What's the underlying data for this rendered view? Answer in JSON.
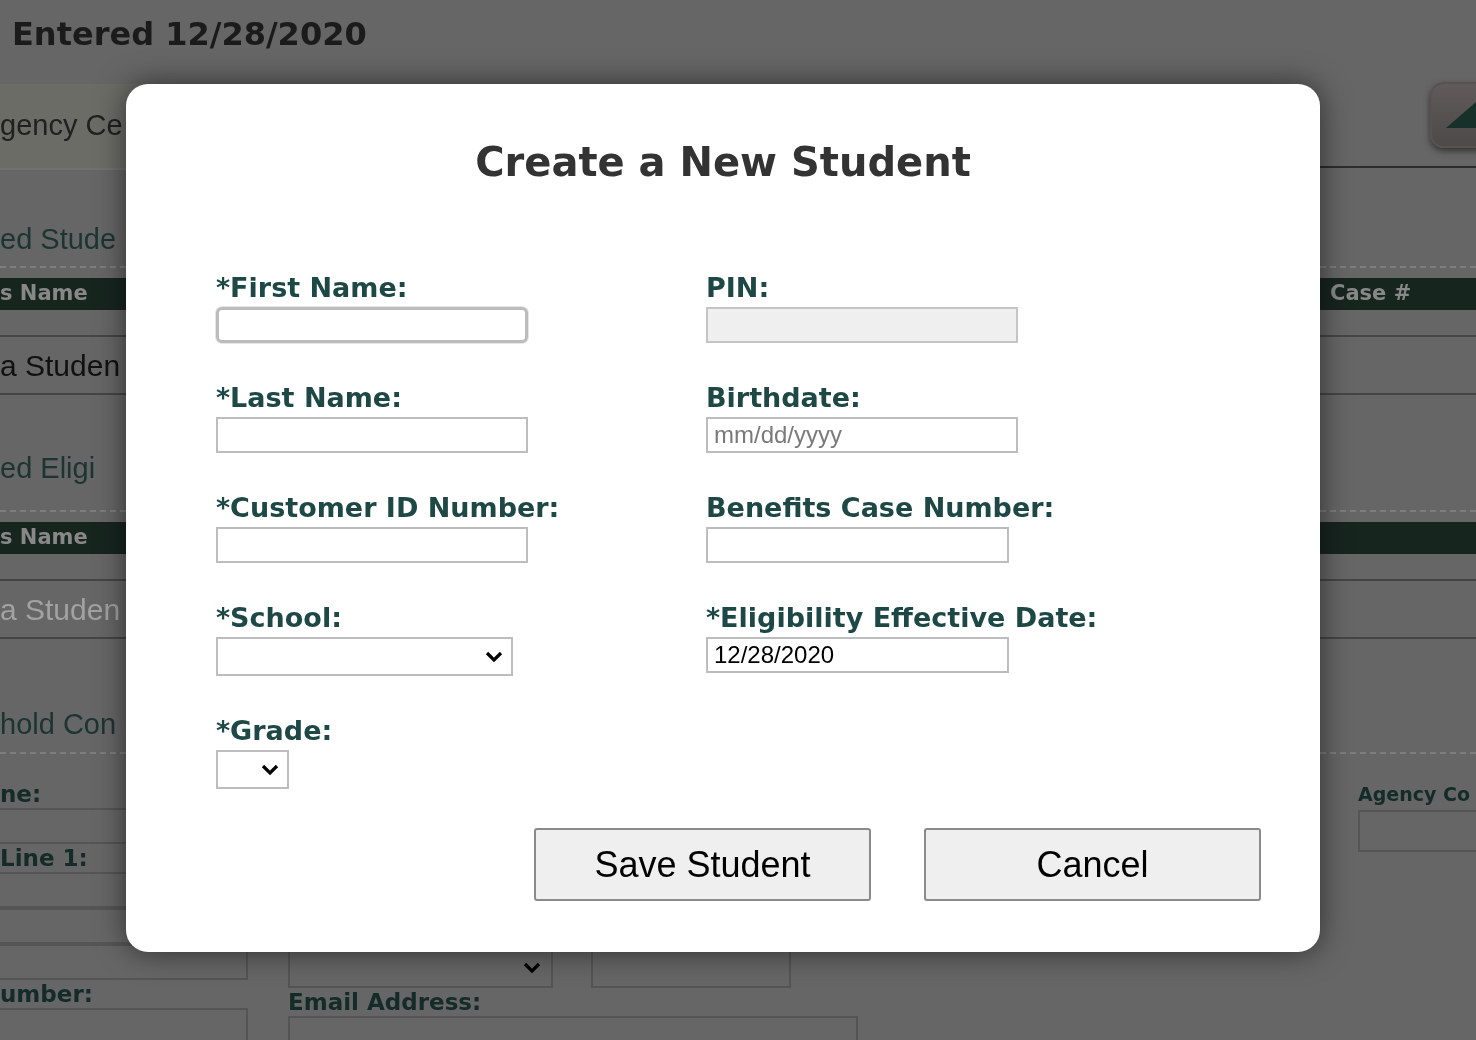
{
  "background": {
    "heading": "Entered 12/28/2020",
    "tab": "gency Ce",
    "tables": [
      {
        "title": "ed Stude",
        "columns": [
          "s Name",
          "Case #"
        ],
        "rows": [
          {
            "cell": "a Studen",
            "muted": false
          }
        ]
      },
      {
        "title": "ed Eligi",
        "columns": [
          "s Name"
        ],
        "rows": [
          {
            "cell": "a Studen",
            "muted": true
          }
        ]
      }
    ],
    "household": {
      "title": "hold Con",
      "left_labels": [
        "ne:",
        "Line 1:",
        "umber:"
      ],
      "middle_label": "Email Address:",
      "right_label": "Agency Co"
    }
  },
  "dialog": {
    "title": "Create a New Student",
    "columns": [
      [
        {
          "label": "*First Name:",
          "kind": "text",
          "focused": true,
          "disabled": false
        },
        {
          "label": "*Last Name:",
          "kind": "text",
          "focused": false,
          "disabled": false
        },
        {
          "label": "*Customer ID Number:",
          "kind": "text",
          "focused": false,
          "disabled": false
        },
        {
          "label": "*School:",
          "kind": "select",
          "focused": false,
          "disabled": false
        },
        {
          "label": "*Grade:",
          "kind": "select",
          "focused": false,
          "disabled": false
        }
      ],
      [
        {
          "label": "PIN:",
          "kind": "text",
          "focused": false,
          "disabled": true
        },
        {
          "label": "Birthdate:",
          "kind": "text",
          "placeholder": "mm/dd/yyyy",
          "focused": false,
          "disabled": false
        },
        {
          "label": "Benefits Case Number:",
          "kind": "text",
          "focused": false,
          "disabled": false
        },
        {
          "label": "*Eligibility Effective Date:",
          "kind": "text",
          "value": "12/28/2020",
          "focused": false,
          "disabled": false
        }
      ]
    ],
    "buttons": [
      "Save Student",
      "Cancel"
    ]
  }
}
